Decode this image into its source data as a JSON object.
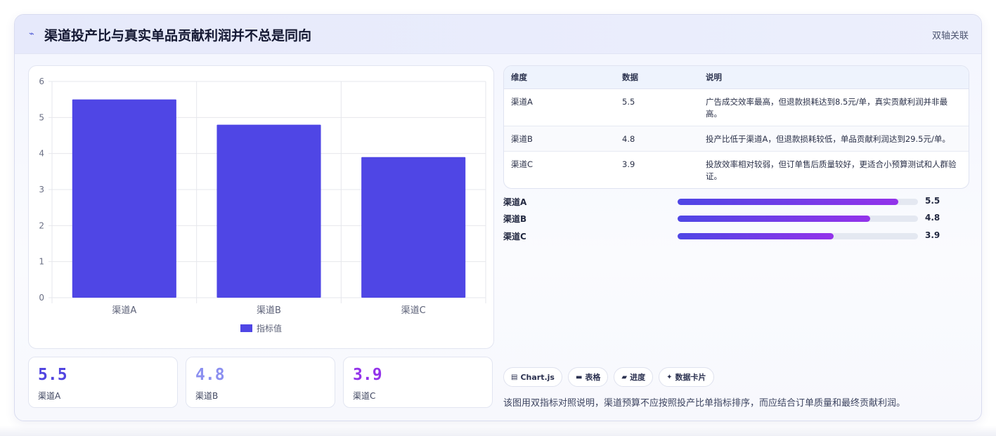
{
  "header": {
    "title": "渠道投产比与真实单品贡献利润并不总是同向",
    "tag": "双轴关联",
    "title_icon": "trend-icon"
  },
  "colors": {
    "bar": "#4f46e5",
    "stat_a": "#5145e0",
    "stat_b": "#8b8ff0",
    "stat_c": "#9333ea",
    "progress_start": "#4f46e5",
    "progress_end": "#9333ea"
  },
  "chart_data": {
    "type": "bar",
    "categories": [
      "渠道A",
      "渠道B",
      "渠道C"
    ],
    "series": [
      {
        "name": "指标值",
        "values": [
          5.5,
          4.8,
          3.9
        ]
      }
    ],
    "ylim": [
      0,
      6
    ],
    "yticks": [
      0,
      1,
      2,
      3,
      4,
      5,
      6
    ],
    "grid": true,
    "legend": "bottom"
  },
  "stats": [
    {
      "value": "5.5",
      "label": "渠道A"
    },
    {
      "value": "4.8",
      "label": "渠道B"
    },
    {
      "value": "3.9",
      "label": "渠道C"
    }
  ],
  "table": {
    "headers": [
      "维度",
      "数据",
      "说明"
    ],
    "rows": [
      {
        "dim": "渠道A",
        "val": "5.5",
        "desc": "广告成交效率最高，但退款损耗达到8.5元/单，真实贡献利润并非最高。"
      },
      {
        "dim": "渠道B",
        "val": "4.8",
        "desc": "投产比低于渠道A，但退款损耗较低，单品贡献利润达到29.5元/单。"
      },
      {
        "dim": "渠道C",
        "val": "3.9",
        "desc": "投放效率相对较弱，但订单售后质量较好，更适合小预算测试和人群验证。"
      }
    ]
  },
  "progress": {
    "max": 6,
    "items": [
      {
        "label": "渠道A",
        "value": 5.5,
        "value_text": "5.5"
      },
      {
        "label": "渠道B",
        "value": 4.8,
        "value_text": "4.8"
      },
      {
        "label": "渠道C",
        "value": 3.9,
        "value_text": "3.9"
      }
    ]
  },
  "chips": [
    {
      "icon": "chart-icon",
      "label": "Chart.js"
    },
    {
      "icon": "table-icon",
      "label": "表格"
    },
    {
      "icon": "progress-icon",
      "label": "进度"
    },
    {
      "icon": "sparkle-icon",
      "label": "数据卡片"
    }
  ],
  "footnote": "该图用双指标对照说明，渠道预算不应按照投产比单指标排序，而应结合订单质量和最终贡献利润。"
}
